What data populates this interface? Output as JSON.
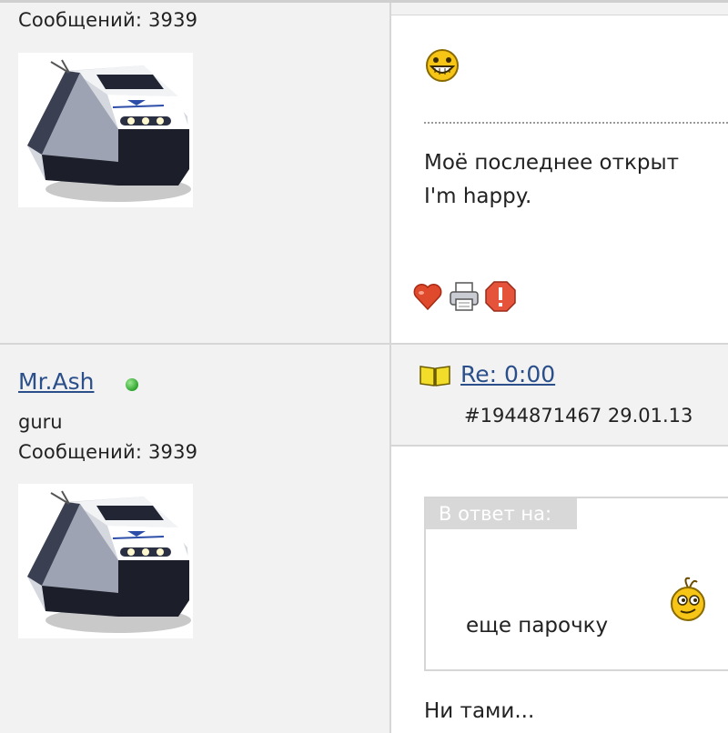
{
  "post1": {
    "post_count": "Сообщений: 3939",
    "body_line1": "Моё последнее открыт",
    "body_line2": "I'm happy.",
    "icons": [
      "grin-smiley-icon",
      "heart-icon",
      "printer-icon",
      "report-icon"
    ]
  },
  "post2": {
    "username": "Mr.Ash",
    "rank": "guru",
    "post_count": "Сообщений: 3939",
    "title": "Re: 0:00",
    "meta": "#1944871467 29.01.13",
    "quote_label": "В ответ на:",
    "quote_text": "еще парочку",
    "reply_text": "Ни тами..."
  },
  "colors": {
    "link": "#2a4f8a",
    "sidebar_bg": "#f2f2f2",
    "online": "#2ea32e"
  }
}
